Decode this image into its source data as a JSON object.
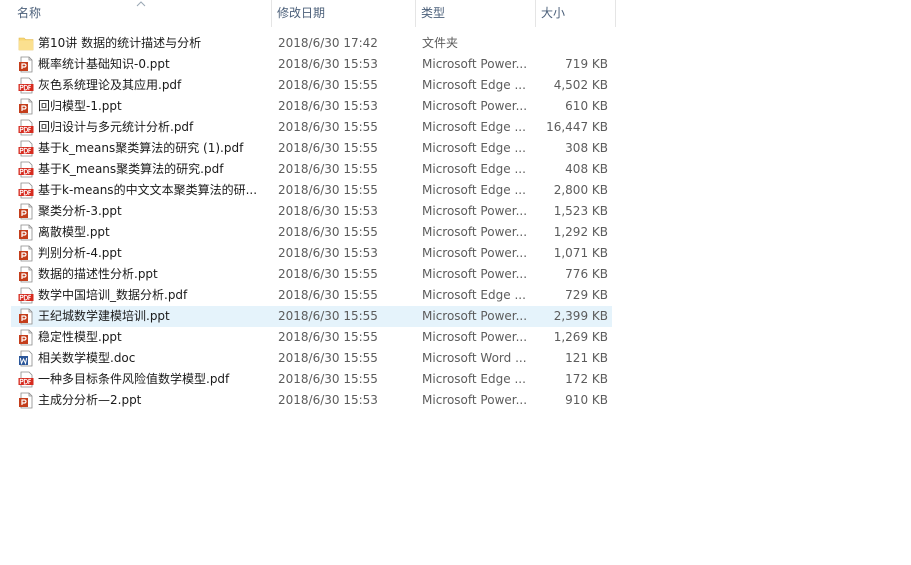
{
  "columns": {
    "name": "名称",
    "date": "修改日期",
    "type": "类型",
    "size": "大小"
  },
  "sort": {
    "column": "name",
    "direction": "ascending",
    "icon": "chevron-up-icon"
  },
  "colors": {
    "header_text": "#4c607a",
    "selected_row": "#e5f3fb",
    "folder": "#f8d775",
    "ppt": "#c43e1c",
    "pdf": "#d62b1f",
    "doc": "#2b579a"
  },
  "files": [
    {
      "name": "第10讲 数据的统计描述与分析",
      "date": "2018/6/30 17:42",
      "type": "文件夹",
      "size": "",
      "icon": "folder-icon",
      "kind": "folder"
    },
    {
      "name": "概率统计基础知识-0.ppt",
      "date": "2018/6/30 15:53",
      "type": "Microsoft Power...",
      "size": "719 KB",
      "icon": "ppt-file-icon",
      "kind": "ppt"
    },
    {
      "name": "灰色系统理论及其应用.pdf",
      "date": "2018/6/30 15:55",
      "type": "Microsoft Edge ...",
      "size": "4,502 KB",
      "icon": "pdf-file-icon",
      "kind": "pdf"
    },
    {
      "name": "回归模型-1.ppt",
      "date": "2018/6/30 15:53",
      "type": "Microsoft Power...",
      "size": "610 KB",
      "icon": "ppt-file-icon",
      "kind": "ppt"
    },
    {
      "name": "回归设计与多元统计分析.pdf",
      "date": "2018/6/30 15:55",
      "type": "Microsoft Edge ...",
      "size": "16,447 KB",
      "icon": "pdf-file-icon",
      "kind": "pdf"
    },
    {
      "name": "基于k_means聚类算法的研究 (1).pdf",
      "date": "2018/6/30 15:55",
      "type": "Microsoft Edge ...",
      "size": "308 KB",
      "icon": "pdf-file-icon",
      "kind": "pdf"
    },
    {
      "name": "基于K_means聚类算法的研究.pdf",
      "date": "2018/6/30 15:55",
      "type": "Microsoft Edge ...",
      "size": "408 KB",
      "icon": "pdf-file-icon",
      "kind": "pdf"
    },
    {
      "name": "基于k-means的中文文本聚类算法的研...",
      "date": "2018/6/30 15:55",
      "type": "Microsoft Edge ...",
      "size": "2,800 KB",
      "icon": "pdf-file-icon",
      "kind": "pdf"
    },
    {
      "name": "聚类分析-3.ppt",
      "date": "2018/6/30 15:53",
      "type": "Microsoft Power...",
      "size": "1,523 KB",
      "icon": "ppt-file-icon",
      "kind": "ppt"
    },
    {
      "name": "离散模型.ppt",
      "date": "2018/6/30 15:55",
      "type": "Microsoft Power...",
      "size": "1,292 KB",
      "icon": "ppt-file-icon",
      "kind": "ppt"
    },
    {
      "name": "判别分析-4.ppt",
      "date": "2018/6/30 15:53",
      "type": "Microsoft Power...",
      "size": "1,071 KB",
      "icon": "ppt-file-icon",
      "kind": "ppt"
    },
    {
      "name": "数据的描述性分析.ppt",
      "date": "2018/6/30 15:55",
      "type": "Microsoft Power...",
      "size": "776 KB",
      "icon": "ppt-file-icon",
      "kind": "ppt"
    },
    {
      "name": "数学中国培训_数据分析.pdf",
      "date": "2018/6/30 15:55",
      "type": "Microsoft Edge ...",
      "size": "729 KB",
      "icon": "pdf-file-icon",
      "kind": "pdf"
    },
    {
      "name": "王纪城数学建模培训.ppt",
      "date": "2018/6/30 15:55",
      "type": "Microsoft Power...",
      "size": "2,399 KB",
      "icon": "ppt-file-icon",
      "kind": "ppt",
      "selected": true
    },
    {
      "name": "稳定性模型.ppt",
      "date": "2018/6/30 15:55",
      "type": "Microsoft Power...",
      "size": "1,269 KB",
      "icon": "ppt-file-icon",
      "kind": "ppt"
    },
    {
      "name": "相关数学模型.doc",
      "date": "2018/6/30 15:55",
      "type": "Microsoft Word ...",
      "size": "121 KB",
      "icon": "doc-file-icon",
      "kind": "doc"
    },
    {
      "name": "一种多目标条件风险值数学模型.pdf",
      "date": "2018/6/30 15:55",
      "type": "Microsoft Edge ...",
      "size": "172 KB",
      "icon": "pdf-file-icon",
      "kind": "pdf"
    },
    {
      "name": "主成分分析—2.ppt",
      "date": "2018/6/30 15:53",
      "type": "Microsoft Power...",
      "size": "910 KB",
      "icon": "ppt-file-icon",
      "kind": "ppt"
    }
  ]
}
